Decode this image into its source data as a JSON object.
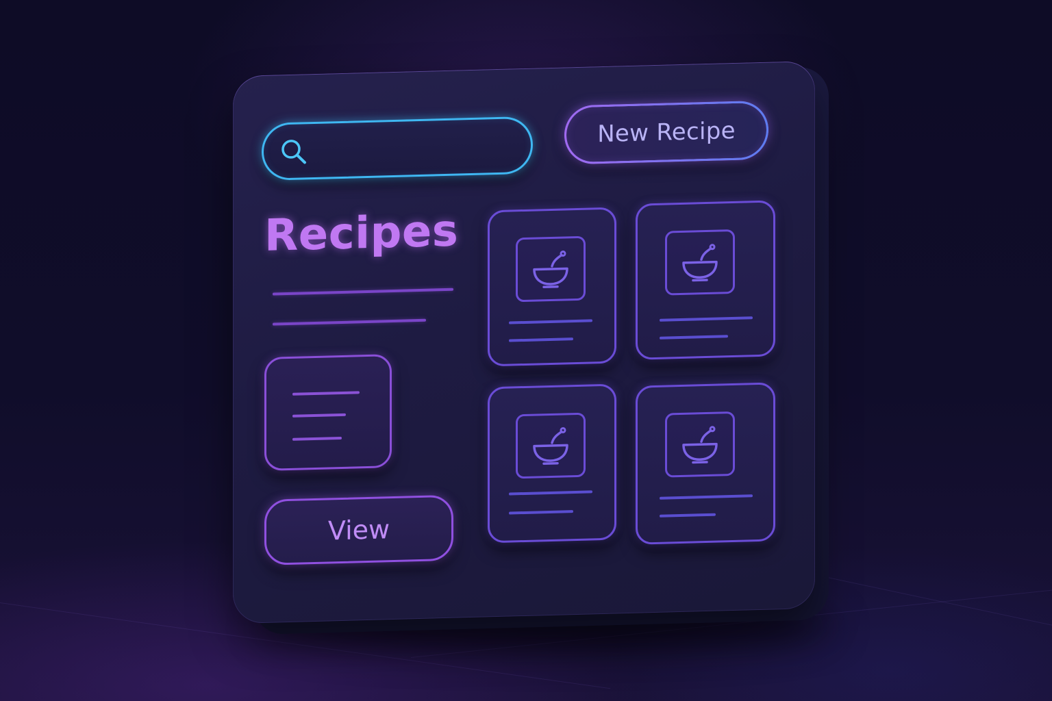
{
  "search": {
    "placeholder": "",
    "value": ""
  },
  "toolbar": {
    "new_recipe_label": "New Recipe"
  },
  "main": {
    "title": "Recipes",
    "view_label": "View"
  },
  "icons": {
    "search": "search-icon",
    "recipe": "bowl-icon"
  },
  "colors": {
    "search_accent": "#3fb7f2",
    "primary_accent": "#a06af0",
    "title": "#c078f2",
    "card_border": "#6a4cd6",
    "panel_bg": "#1e1b42",
    "page_bg": "#0e0c26"
  }
}
